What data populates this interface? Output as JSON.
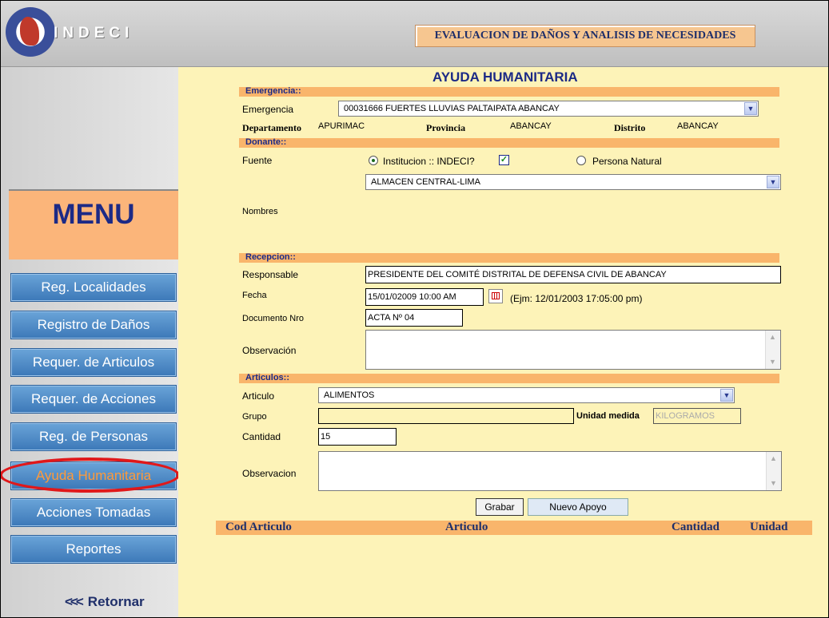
{
  "header": {
    "brand": "INDECI",
    "title": "EVALUACION DE DAÑOS Y ANALISIS DE NECESIDADES"
  },
  "sidebar": {
    "menu_label": "MENU",
    "items": [
      {
        "label": "Reg. Localidades"
      },
      {
        "label": "Registro de Daños"
      },
      {
        "label": "Requer. de Articulos"
      },
      {
        "label": "Requer. de Acciones"
      },
      {
        "label": "Reg. de Personas"
      },
      {
        "label": "Ayuda Humanitaria"
      },
      {
        "label": "Acciones Tomadas"
      },
      {
        "label": "Reportes"
      }
    ],
    "active_item": "Ayuda Humanitaria",
    "retornar_label": "Retornar"
  },
  "form": {
    "page_title": "AYUDA HUMANITARIA",
    "emergencia": {
      "section": "Emergencia::",
      "label": "Emergencia",
      "value": "00031666 FUERTES LLUVIAS PALTAIPATA ABANCAY",
      "departamento_label": "Departamento",
      "departamento_value": "APURIMAC",
      "provincia_label": "Provincia",
      "provincia_value": "ABANCAY",
      "distrito_label": "Distrito",
      "distrito_value": "ABANCAY"
    },
    "donante": {
      "section": "Donante::",
      "fuente_label": "Fuente",
      "institucion_label": "Institucion :: INDECI?",
      "institucion_selected": true,
      "indeci_checked": true,
      "persona_label": "Persona Natural",
      "almacen_value": "ALMACEN CENTRAL-LIMA",
      "nombres_label": "Nombres"
    },
    "recepcion": {
      "section": "Recepcion::",
      "responsable_label": "Responsable",
      "responsable_value": "PRESIDENTE DEL COMITÉ DISTRITAL DE DEFENSA CIVIL DE ABANCAY",
      "fecha_label": "Fecha",
      "fecha_value": "15/01/02009 10:00 AM",
      "fecha_hint": "(Ejm: 12/01/2003 17:05:00 pm)",
      "documento_label": "Documento Nro",
      "documento_value": "ACTA Nº 04",
      "observacion_label": "Observación"
    },
    "articulos": {
      "section": "Articulos::",
      "articulo_label": "Articulo",
      "articulo_value": "ALIMENTOS",
      "grupo_label": "Grupo",
      "unidad_label": "Unidad medida",
      "unidad_value": "KILOGRAMOS",
      "cantidad_label": "Cantidad",
      "cantidad_value": "15",
      "observacion_label": "Observacion"
    },
    "buttons": {
      "grabar": "Grabar",
      "nuevo": "Nuevo Apoyo"
    },
    "grid_headers": [
      "Cod Articulo",
      "Articulo",
      "Cantidad",
      "Unidad"
    ]
  }
}
